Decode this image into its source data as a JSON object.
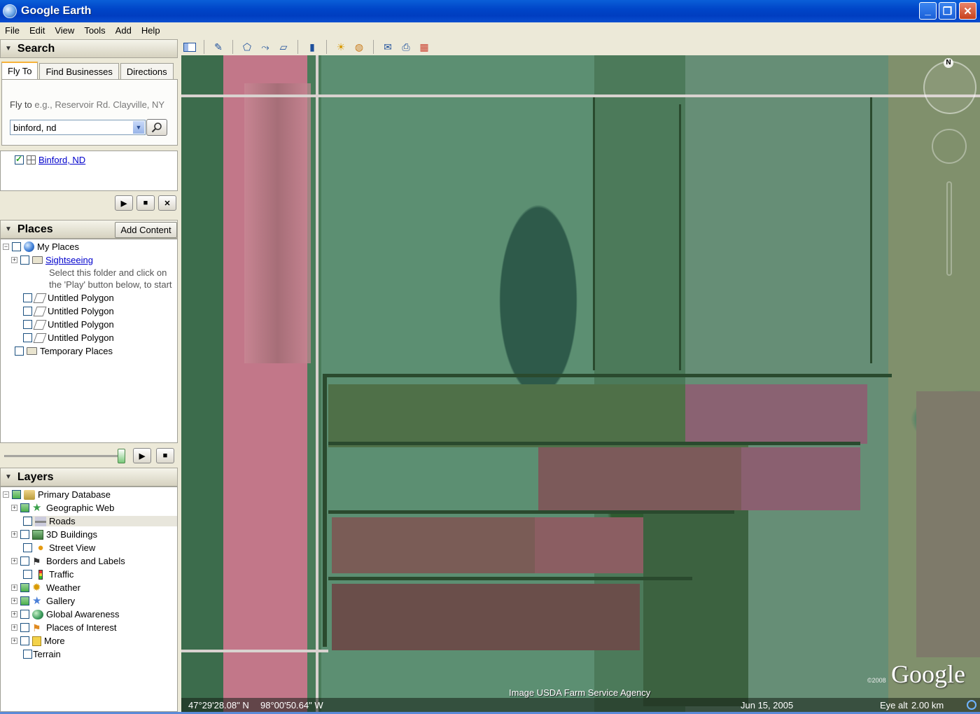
{
  "window": {
    "title": "Google Earth"
  },
  "menu": [
    "File",
    "Edit",
    "View",
    "Tools",
    "Add",
    "Help"
  ],
  "search": {
    "header": "Search",
    "tabs": [
      "Fly To",
      "Find Businesses",
      "Directions"
    ],
    "fly_to_label": "Fly to",
    "fly_to_hint": "e.g., Reservoir Rd. Clayville, NY",
    "input_value": "binford, nd",
    "result": "Binford, ND"
  },
  "places": {
    "header": "Places",
    "add_content": "Add Content",
    "my_places": "My Places",
    "sightseeing": "Sightseeing",
    "sightseeing_desc_1": "Select this folder and click on",
    "sightseeing_desc_2": "the 'Play' button below, to start",
    "polygons": [
      "Untitled Polygon",
      "Untitled Polygon",
      "Untitled Polygon",
      "Untitled Polygon"
    ],
    "temporary": "Temporary Places"
  },
  "layers": {
    "header": "Layers",
    "items": [
      "Primary Database",
      "Geographic Web",
      "Roads",
      "3D Buildings",
      "Street View",
      "Borders and Labels",
      "Traffic",
      "Weather",
      "Gallery",
      "Global Awareness",
      "Places of Interest",
      "More",
      "Terrain"
    ]
  },
  "map": {
    "compass_north": "N",
    "logo": "Google",
    "copyright": "©2008",
    "attribution": "Image USDA Farm Service Agency",
    "latitude": "47°29'28.08\" N",
    "longitude": "98°00'50.64\" W",
    "imagery_date": "Jun 15, 2005",
    "eye_alt_label": "Eye alt",
    "eye_alt_value": "2.00 km"
  },
  "colors": {
    "title_bar": "#0046c8",
    "panel_bg": "#ece9d8",
    "link": "#0000cc",
    "accent_tab": "#f7b33a"
  }
}
